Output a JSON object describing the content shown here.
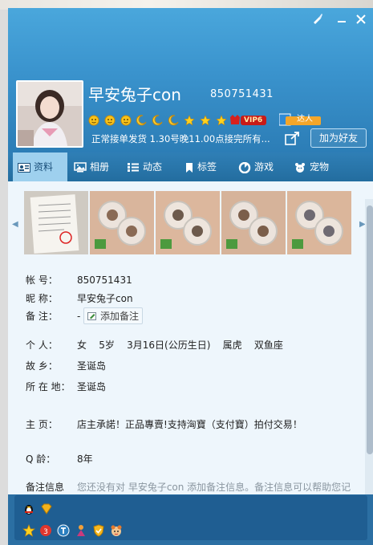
{
  "window": {
    "skin_label": "skin",
    "minimize_label": "—",
    "close_label": "✕"
  },
  "profile": {
    "nickname": "早安兔子con",
    "qq_number": "850751431",
    "vip_label": "VIP6",
    "daren_label": "达人",
    "signature": "正常接单发货  1.30号晚11.00点接完所有...",
    "add_friend_label": "加为好友"
  },
  "tabs": [
    {
      "label": "资料",
      "icon": "profile-card-icon"
    },
    {
      "label": "相册",
      "icon": "photo-icon"
    },
    {
      "label": "动态",
      "icon": "feed-icon"
    },
    {
      "label": "标签",
      "icon": "bookmark-icon"
    },
    {
      "label": "游戏",
      "icon": "game-icon"
    },
    {
      "label": "宠物",
      "icon": "pet-icon"
    }
  ],
  "info": {
    "account_label": "帐    号：",
    "account_value": "850751431",
    "nickname_label": "昵    称：",
    "nickname_value": "早安兔子con",
    "remark_label": "备    注：",
    "remark_value": "-",
    "remark_button": "添加备注",
    "personal_label": "个    人：",
    "personal_value": "女    5岁    3月16日(公历生日)    属虎    双鱼座",
    "hometown_label": "故    乡：",
    "hometown_value": "圣诞岛",
    "location_label": "所 在 地：",
    "location_value": "圣诞岛",
    "homepage_label": "主    页：",
    "homepage_value": "店主承諾！正品專賣!支持洶寶（支付寶）拍付交易！",
    "qage_label": "Q     龄：",
    "qage_value": "8年",
    "remark_info_label": "备注信息",
    "remark_info_value": "您还没有对 早安兔子con 添加备注信息。备注信息可以帮助您记"
  },
  "colors": {
    "header_top": "#4aa7dc",
    "tab_active": "#9ed0ee",
    "content_bg": "#eef6fc",
    "bottom_bar": "#1f5e92"
  }
}
